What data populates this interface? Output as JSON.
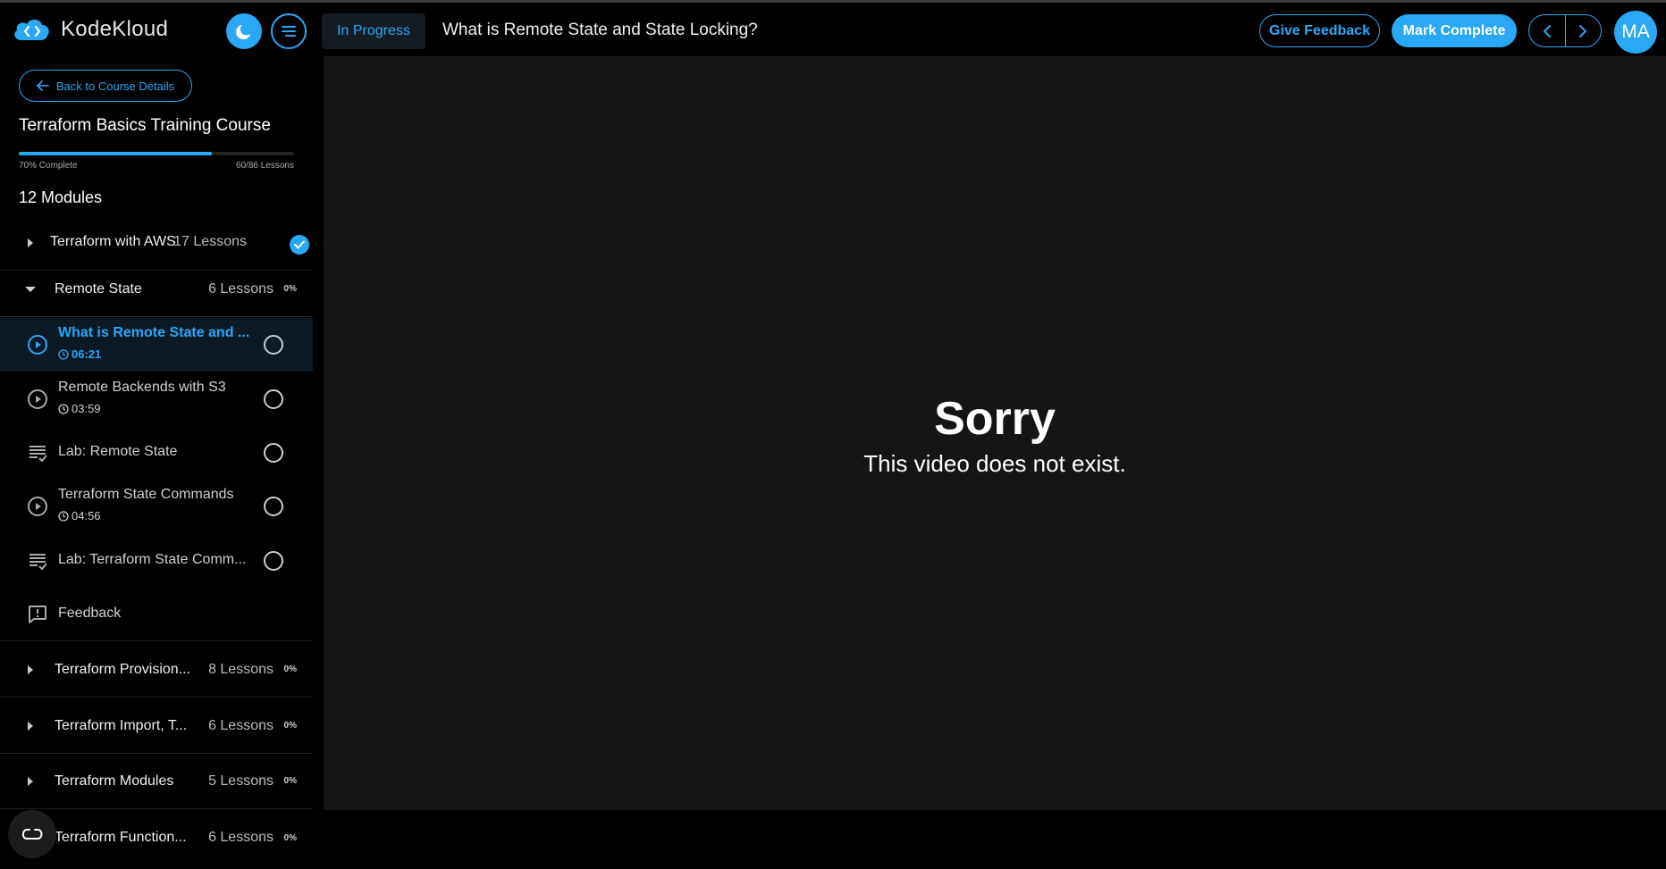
{
  "header": {
    "brand": "KodeKloud",
    "status": "In Progress",
    "lesson_title": "What is Remote State and State Locking?",
    "give_feedback": "Give Feedback",
    "mark_complete": "Mark Complete",
    "avatar_initials": "MA",
    "accent": "#2aa7f5"
  },
  "sidebar": {
    "back_label": "Back to Course Details",
    "course_title": "Terraform Basics Training Course",
    "progress_percent": 70,
    "progress_label": "70% Complete",
    "lessons_label": "60/86 Lessons",
    "modules_count": "12 Modules",
    "modules": [
      {
        "name": "Terraform with AWS",
        "lessons": "17 Lessons",
        "pct": "",
        "completed": true,
        "expanded": false
      },
      {
        "name": "Remote State",
        "lessons": "6 Lessons",
        "pct": "0%",
        "completed": false,
        "expanded": true
      },
      {
        "name": "Terraform Provision...",
        "lessons": "8 Lessons",
        "pct": "0%"
      },
      {
        "name": "Terraform Import, T...",
        "lessons": "6 Lessons",
        "pct": "0%"
      },
      {
        "name": "Terraform Modules",
        "lessons": "5 Lessons",
        "pct": "0%"
      },
      {
        "name": "Terraform Function...",
        "lessons": "6 Lessons",
        "pct": "0%"
      }
    ],
    "lessons": [
      {
        "name": "What is Remote State and ...",
        "time": "06:21",
        "type": "video",
        "active": true
      },
      {
        "name": "Remote Backends with S3",
        "time": "03:59",
        "type": "video"
      },
      {
        "name": "Lab: Remote State",
        "time": "",
        "type": "lab"
      },
      {
        "name": "Terraform State Commands",
        "time": "04:56",
        "type": "video"
      },
      {
        "name": "Lab: Terraform State Comm...",
        "time": "",
        "type": "lab"
      },
      {
        "name": "Feedback",
        "time": "",
        "type": "feedback"
      }
    ]
  },
  "main": {
    "error_title": "Sorry",
    "error_message": "This video does not exist."
  }
}
